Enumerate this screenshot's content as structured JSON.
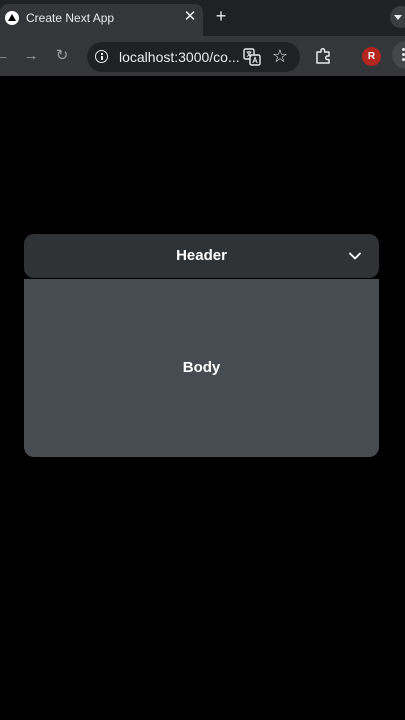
{
  "browser": {
    "tab": {
      "title": "Create Next App",
      "close_glyph": "✕"
    },
    "new_tab_glyph": "+",
    "toolbar": {
      "back_glyph": "←",
      "forward_glyph": "→",
      "reload_glyph": "↻",
      "url": "localhost:3000/co...",
      "star_glyph": "☆",
      "avatar_initial": "R"
    },
    "icons": [
      "nextjs-favicon-icon",
      "close-icon",
      "plus-icon",
      "back-arrow-icon",
      "forward-arrow-icon",
      "reload-icon",
      "info-icon",
      "translate-icon",
      "star-icon",
      "extension-icon",
      "avatar",
      "kebab-menu-icon",
      "chevron-down-icon"
    ],
    "colors": {
      "accent_avatar": "#b3261e",
      "header_bg": "#2f3336",
      "body_bg": "#464c52",
      "page_bg": "#000000"
    }
  },
  "accordion": {
    "header_label": "Header",
    "body_label": "Body"
  }
}
